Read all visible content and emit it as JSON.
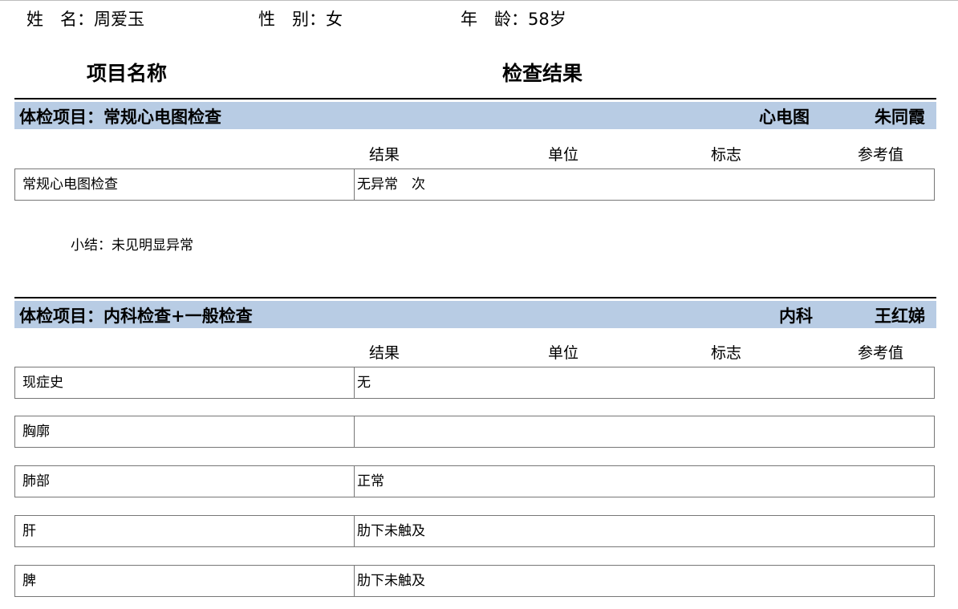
{
  "patient": {
    "name": "姓　名：周爱玉",
    "gender": "性　别：女",
    "age": "年　龄：58岁"
  },
  "column_headers": {
    "item_name": "项目名称",
    "check_result": "检查结果"
  },
  "sections": [
    {
      "title": "体检项目：常规心电图检查",
      "department": "心电图",
      "doctor": "朱同霞",
      "subheaders": [
        "结果",
        "单位",
        "标志",
        "参考值"
      ],
      "rows": [
        {
          "name": "常规心电图检查",
          "result": "无异常　次"
        }
      ],
      "summary": "小结：未见明显异常"
    },
    {
      "title": "体检项目：内科检查+一般检查",
      "department": "内科",
      "doctor": "王红娣",
      "subheaders": [
        "结果",
        "单位",
        "标志",
        "参考值"
      ],
      "rows": [
        {
          "name": "现症史",
          "result": "无"
        },
        {
          "name": "胸廓",
          "result": ""
        },
        {
          "name": "肺部",
          "result": "正常"
        },
        {
          "name": "肝",
          "result": "肋下未触及"
        },
        {
          "name": "脾",
          "result": "肋下未触及"
        }
      ]
    }
  ]
}
